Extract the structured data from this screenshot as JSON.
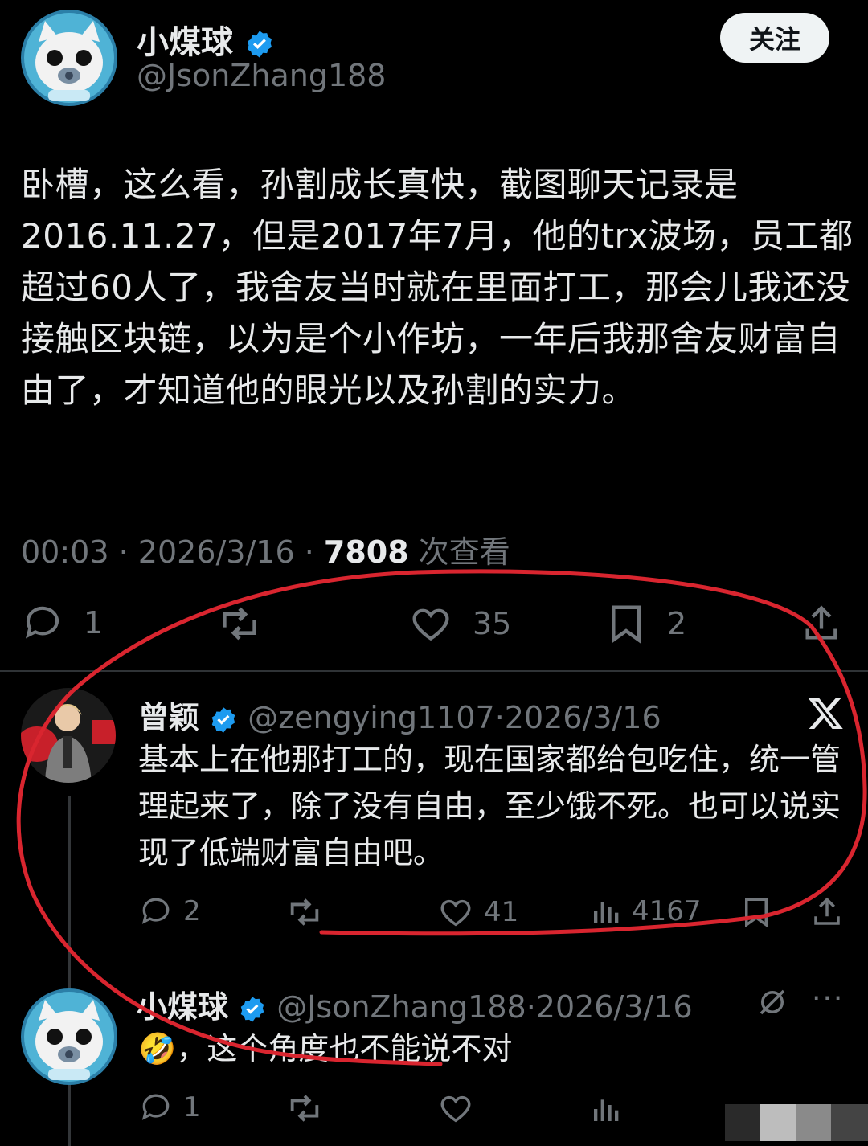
{
  "main_tweet": {
    "author_name": "小煤球",
    "author_handle": "@JsonZhang188",
    "follow_label": "关注",
    "text": "卧槽，这么看，孙割成长真快，截图聊天记录是2016.11.27，但是2017年7月，他的trx波场，员工都超过60人了，我舍友当时就在里面打工，那会儿我还没接触区块链，以为是个小作坊，一年后我那舍友财富自由了，才知道他的眼光以及孙割的实力。",
    "time": "00:03",
    "date": "2026/3/16",
    "views": "7808",
    "views_label": "次查看",
    "reply_count": "1",
    "like_count": "35",
    "bookmark_count": "2"
  },
  "reply1": {
    "author_name": "曾颖",
    "author_handle": "@zengying1107",
    "date": "2026/3/16",
    "text": "基本上在他那打工的，现在国家都给包吃住，统一管理起来了，除了没有自由，至少饿不死。也可以说实现了低端财富自由吧。",
    "reply_count": "2",
    "like_count": "41",
    "view_count": "4167"
  },
  "reply2": {
    "author_name": "小煤球",
    "author_handle": "@JsonZhang188",
    "date": "2026/3/16",
    "emoji": "🤣",
    "text": "，这个角度也不能说不对",
    "reply_count": "1"
  },
  "colors": {
    "background": "#000000",
    "text": "#e7e9ea",
    "muted": "#71767b",
    "verified": "#1d9bf0",
    "annotation": "#d9252f"
  },
  "icons": [
    "verified-icon",
    "reply-icon",
    "retweet-icon",
    "like-icon",
    "bookmark-icon",
    "share-icon",
    "views-icon",
    "x-logo-icon",
    "more-icon",
    "grok-icon"
  ]
}
